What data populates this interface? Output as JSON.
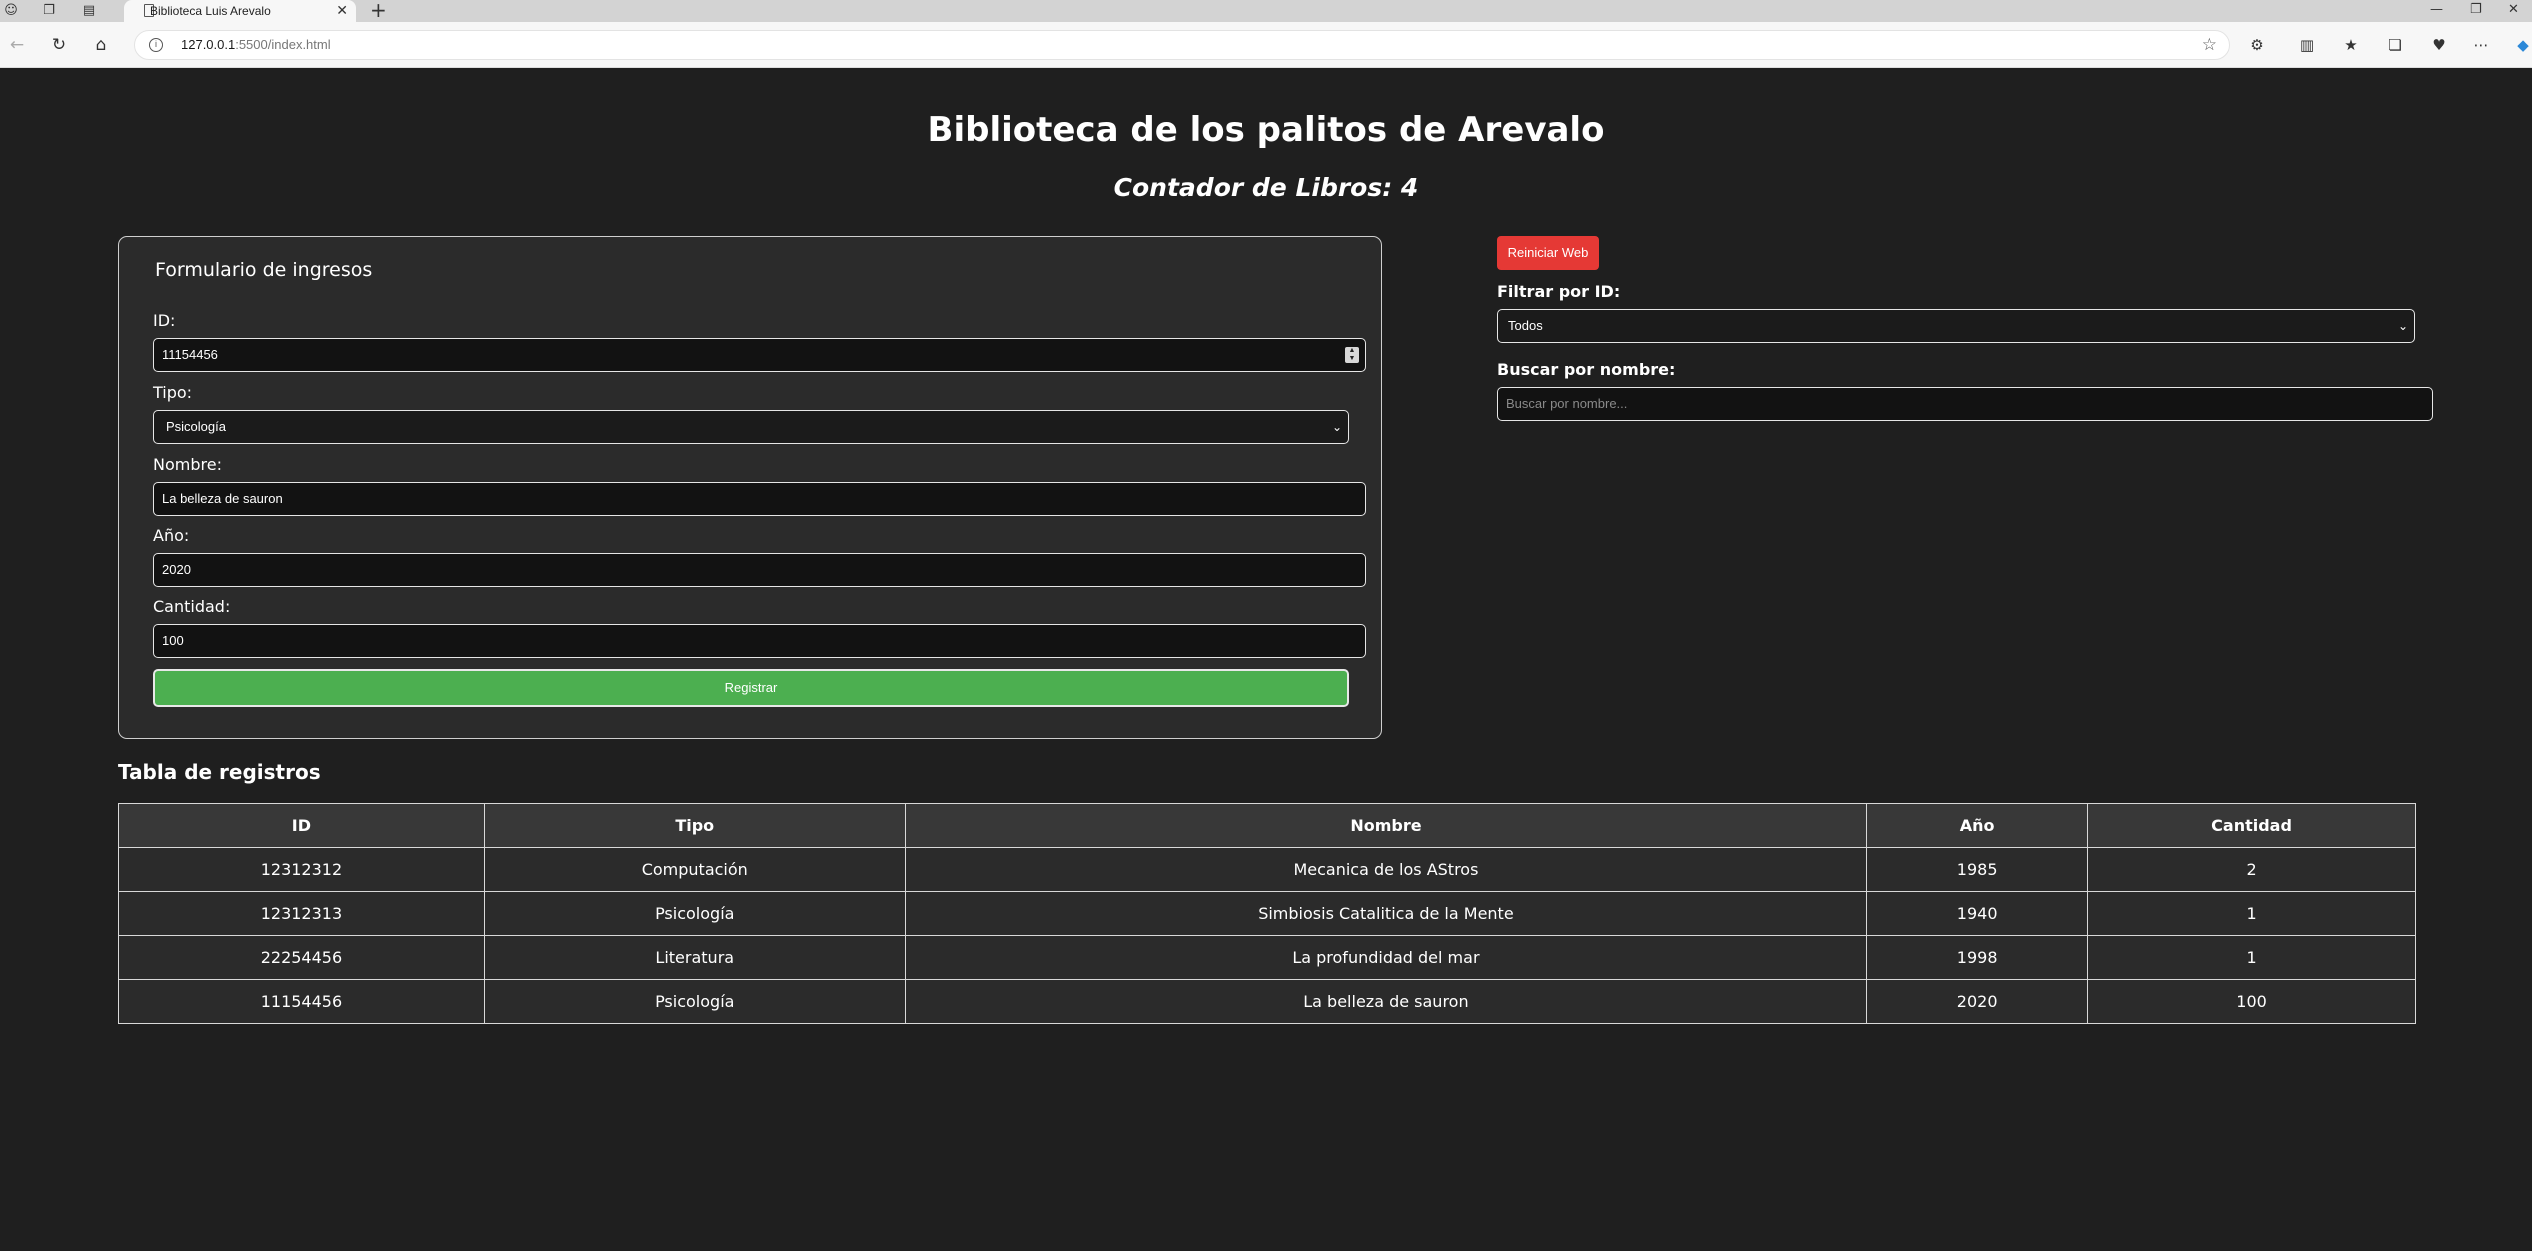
{
  "browser": {
    "tab_title": "Biblioteca Luis Arevalo",
    "url_host": "127.0.0.1",
    "url_rest": ":5500/index.html"
  },
  "header": {
    "title": "Biblioteca de los palitos de Arevalo",
    "counter_label": "Contador de Libros: 4"
  },
  "form": {
    "legend": "Formulario de ingresos",
    "id_label": "ID:",
    "id_value": "11154456",
    "tipo_label": "Tipo:",
    "tipo_value": "Psicología",
    "nombre_label": "Nombre:",
    "nombre_value": "La belleza de sauron",
    "anio_label": "Año:",
    "anio_value": "2020",
    "cantidad_label": "Cantidad:",
    "cantidad_value": "100",
    "submit_label": "Registrar"
  },
  "controls": {
    "reset_label": "Reiniciar Web",
    "filter_label": "Filtrar por ID:",
    "filter_value": "Todos",
    "search_label": "Buscar por nombre:",
    "search_placeholder": "Buscar por nombre..."
  },
  "table": {
    "title": "Tabla de registros",
    "headers": [
      "ID",
      "Tipo",
      "Nombre",
      "Año",
      "Cantidad"
    ],
    "rows": [
      [
        "12312312",
        "Computación",
        "Mecanica de los AStros",
        "1985",
        "2"
      ],
      [
        "12312313",
        "Psicología",
        "Simbiosis Catalitica de la Mente",
        "1940",
        "1"
      ],
      [
        "22254456",
        "Literatura",
        "La profundidad del mar",
        "1998",
        "1"
      ],
      [
        "11154456",
        "Psicología",
        "La belleza de sauron",
        "2020",
        "100"
      ]
    ]
  },
  "colors": {
    "register_button": "#4caf50",
    "reset_button": "#e53935",
    "background": "#1f1f1f"
  }
}
